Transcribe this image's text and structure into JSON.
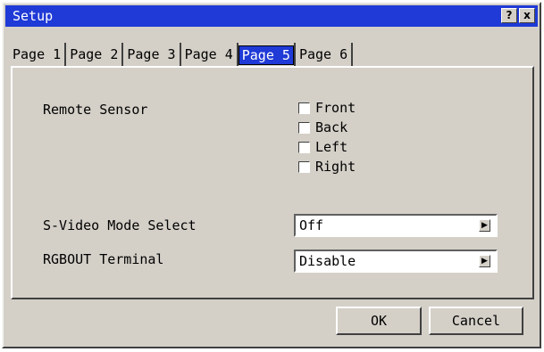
{
  "window": {
    "title": "Setup",
    "help_button": "?",
    "close_button": "x"
  },
  "tabs": [
    {
      "label": "Page 1",
      "active": false
    },
    {
      "label": "Page 2",
      "active": false
    },
    {
      "label": "Page 3",
      "active": false
    },
    {
      "label": "Page 4",
      "active": false
    },
    {
      "label": "Page 5",
      "active": true
    },
    {
      "label": "Page 6",
      "active": false
    }
  ],
  "remote_sensor": {
    "label": "Remote Sensor",
    "options": [
      {
        "label": "Front",
        "checked": false
      },
      {
        "label": "Back",
        "checked": false
      },
      {
        "label": "Left",
        "checked": false
      },
      {
        "label": "Right",
        "checked": false
      }
    ]
  },
  "svideo": {
    "label": "S-Video Mode Select",
    "value": "Off"
  },
  "rgbout": {
    "label": "RGBOUT Terminal",
    "value": "Disable"
  },
  "footer": {
    "ok_label": "OK",
    "cancel_label": "Cancel"
  },
  "colors": {
    "titlebar": "#1f3ad6",
    "face": "#d4d0c8"
  }
}
